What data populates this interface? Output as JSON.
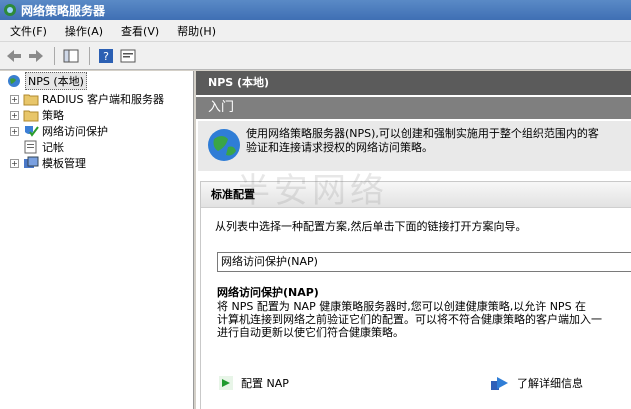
{
  "window": {
    "title": "网络策略服务器"
  },
  "menu": [
    {
      "label": "文件(F)"
    },
    {
      "label": "操作(A)"
    },
    {
      "label": "查看(V)"
    },
    {
      "label": "帮助(H)"
    }
  ],
  "tree": {
    "root": "NPS (本地)",
    "items": [
      {
        "label": "RADIUS 客户端和服务器",
        "icon": "folder-icon"
      },
      {
        "label": "策略",
        "icon": "folder-icon"
      },
      {
        "label": "网络访问保护",
        "icon": "shield-check-icon"
      },
      {
        "label": "记帐",
        "icon": "accounting-icon"
      },
      {
        "label": "模板管理",
        "icon": "templates-icon"
      }
    ]
  },
  "content": {
    "title": "NPS (本地)",
    "section": "入门",
    "intro_line1": "使用网络策略服务器(NPS),可以创建和强制实施用于整个组织范围内的客",
    "intro_line2": "验证和连接请求授权的网络访问策略。",
    "panel": {
      "heading": "标准配置",
      "sub": "从列表中选择一种配置方案,然后单击下面的链接打开方案向导。",
      "combo_value": "网络访问保护(NAP)",
      "nap_heading": "网络访问保护(NAP)",
      "nap_desc1": "将 NPS 配置为 NAP 健康策略服务器时,您可以创建健康策略,以允许 NPS 在",
      "nap_desc2": "计算机连接到网络之前验证它们的配置。可以将不符合健康策略的客户端加入一",
      "nap_desc3": "进行自动更新以使它们符合健康策略。",
      "link_configure": "配置 NAP",
      "link_learn": "了解详细信息"
    },
    "watermark": "半安网络"
  },
  "colors": {
    "title_bar": "#3f6fb4",
    "content_title": "#5b5b5b",
    "section_bar": "#7f7f7f"
  }
}
